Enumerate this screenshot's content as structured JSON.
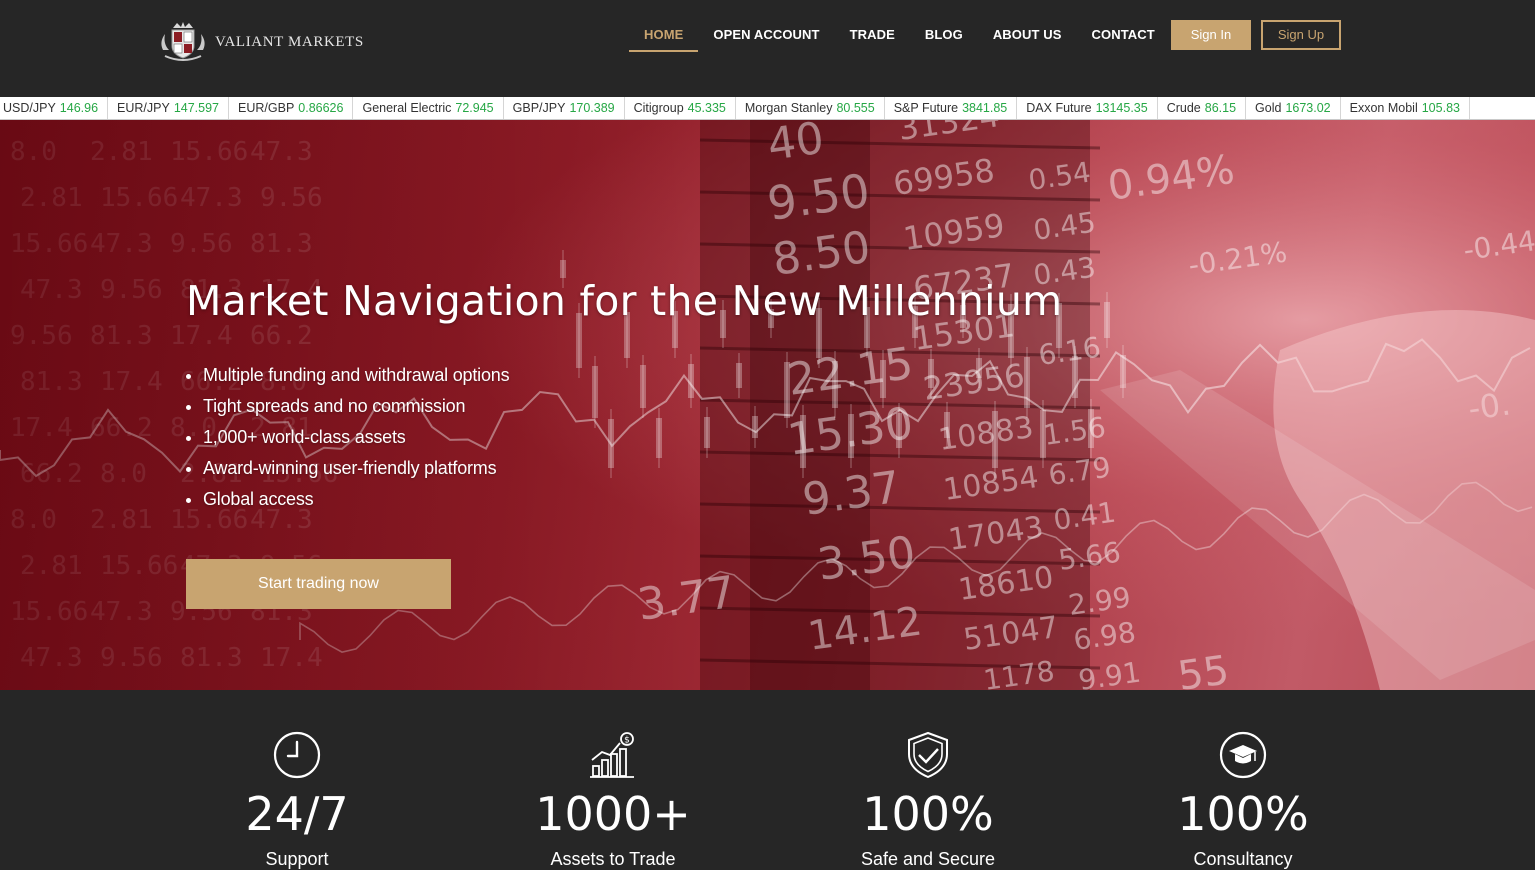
{
  "brand": {
    "name": "VALIANT MARKETS",
    "icon": "crest-logo-icon"
  },
  "nav": {
    "items": [
      {
        "label": "HOME",
        "active": true
      },
      {
        "label": "OPEN ACCOUNT",
        "active": false
      },
      {
        "label": "TRADE",
        "active": false
      },
      {
        "label": "BLOG",
        "active": false
      },
      {
        "label": "ABOUT US",
        "active": false
      },
      {
        "label": "CONTACT",
        "active": false
      }
    ],
    "sign_in": "Sign In",
    "sign_up": "Sign Up"
  },
  "ticker": [
    {
      "name": "USD/JPY",
      "value": "146.96"
    },
    {
      "name": "EUR/JPY",
      "value": "147.597"
    },
    {
      "name": "EUR/GBP",
      "value": "0.86626"
    },
    {
      "name": "General Electric",
      "value": "72.945"
    },
    {
      "name": "GBP/JPY",
      "value": "170.389"
    },
    {
      "name": "Citigroup",
      "value": "45.335"
    },
    {
      "name": "Morgan Stanley",
      "value": "80.555"
    },
    {
      "name": "S&P Future",
      "value": "3841.85"
    },
    {
      "name": "DAX Future",
      "value": "13145.35"
    },
    {
      "name": "Crude",
      "value": "86.15"
    },
    {
      "name": "Gold",
      "value": "1673.02"
    },
    {
      "name": "Exxon Mobil",
      "value": "105.83"
    }
  ],
  "hero": {
    "title": "Market Navigation for the New Millennium",
    "bullets": [
      "Multiple funding and withdrawal options",
      "Tight spreads and no commission",
      "1,000+ world-class assets",
      "Award-winning user-friendly platforms",
      "Global access"
    ],
    "cta": "Start trading now",
    "background_digits": [
      "40",
      "9.50",
      "8.50",
      "22.15",
      "15.30",
      "9.37",
      "3.50",
      "14.12",
      "31324",
      "69958",
      "10959",
      "67237",
      "15301",
      "23956",
      "10883",
      "10854",
      "17043",
      "18610",
      "51047",
      "1178",
      "0.54",
      "0.45",
      "0.43",
      "6.16",
      "1.56",
      "6.79",
      "0.41",
      "5.66",
      "2.99",
      "6.98",
      "9.91",
      "0.94%",
      "-0.21%",
      "-0.44",
      "-0.",
      "55",
      "3.77"
    ]
  },
  "features": [
    {
      "icon": "clock-icon",
      "value": "24/7",
      "label": "Support"
    },
    {
      "icon": "growth-chart-dollar-icon",
      "value": "1000+",
      "label": "Assets to Trade"
    },
    {
      "icon": "shield-check-icon",
      "value": "100%",
      "label": "Safe and Secure"
    },
    {
      "icon": "graduation-cap-icon",
      "value": "100%",
      "label": "Consultancy"
    }
  ],
  "colors": {
    "gold": "#c8a470",
    "dark": "#262626",
    "ticker_green": "#26a745",
    "hero_red": "#9b2430"
  }
}
